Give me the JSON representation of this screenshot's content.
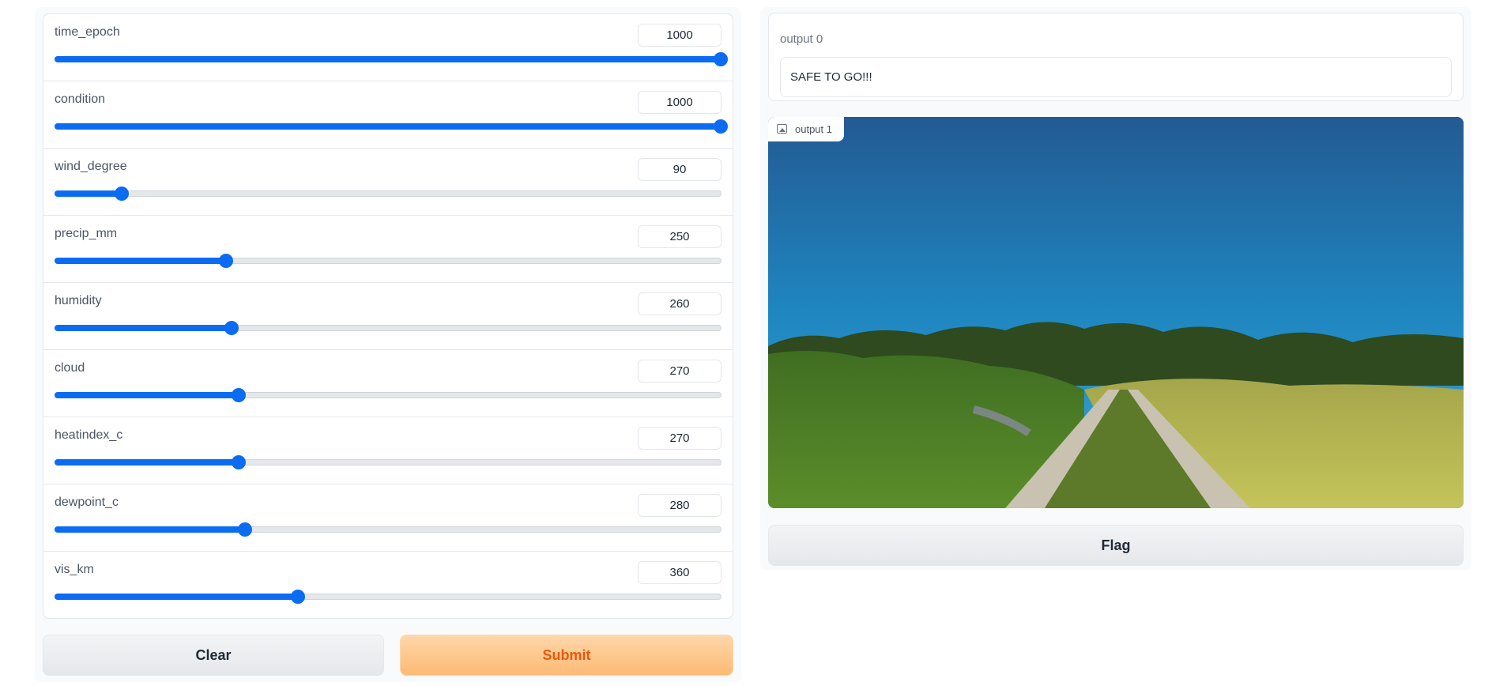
{
  "sliders": [
    {
      "label": "time_epoch",
      "value": "1000",
      "fraction": 1.0
    },
    {
      "label": "condition",
      "value": "1000",
      "fraction": 1.0
    },
    {
      "label": "wind_degree",
      "value": "90",
      "fraction": 0.1
    },
    {
      "label": "precip_mm",
      "value": "250",
      "fraction": 0.257
    },
    {
      "label": "humidity",
      "value": "260",
      "fraction": 0.265
    },
    {
      "label": "cloud",
      "value": "270",
      "fraction": 0.276
    },
    {
      "label": "heatindex_c",
      "value": "270",
      "fraction": 0.276
    },
    {
      "label": "dewpoint_c",
      "value": "280",
      "fraction": 0.285
    },
    {
      "label": "vis_km",
      "value": "360",
      "fraction": 0.365
    }
  ],
  "buttons": {
    "clear": "Clear",
    "submit": "Submit",
    "flag": "Flag"
  },
  "output0": {
    "label": "output 0",
    "text": "SAFE TO GO!!!"
  },
  "output1": {
    "label": "output 1",
    "icon": "image-icon"
  },
  "colors": {
    "slider_accent": "#0b6cf2",
    "submit_text": "#ea580c",
    "submit_bg": "#fdba74"
  }
}
